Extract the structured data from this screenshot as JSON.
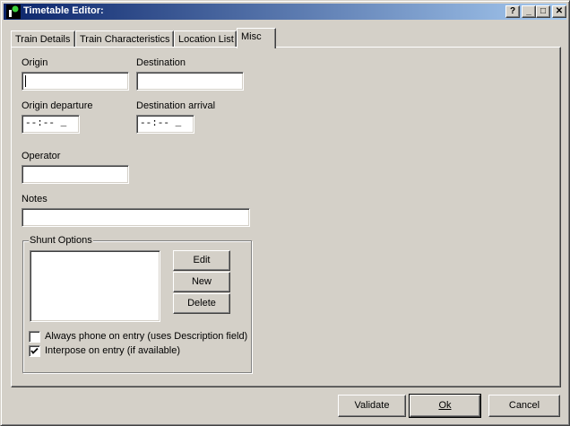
{
  "window": {
    "title": "Timetable Editor:",
    "help_glyph": "?",
    "min_glyph": "_",
    "max_glyph": "□",
    "close_glyph": "✕"
  },
  "tabs": [
    {
      "label": "Train Details",
      "active": false
    },
    {
      "label": "Train Characteristics",
      "active": false
    },
    {
      "label": "Location List",
      "active": false
    },
    {
      "label": "Misc",
      "active": true
    }
  ],
  "misc": {
    "origin_label": "Origin",
    "origin_value": "",
    "destination_label": "Destination",
    "destination_value": "",
    "origin_departure_label": "Origin departure",
    "origin_departure_value": "--:-- _",
    "destination_arrival_label": "Destination arrival",
    "destination_arrival_value": "--:-- _",
    "operator_label": "Operator",
    "operator_value": "",
    "notes_label": "Notes",
    "notes_value": ""
  },
  "shunt": {
    "group_title": "Shunt Options",
    "edit_label": "Edit",
    "new_label": "New",
    "delete_label": "Delete",
    "always_phone_label": "Always phone on entry (uses Description field)",
    "always_phone_checked": false,
    "interpose_label": "Interpose on entry (if available)",
    "interpose_checked": true
  },
  "footer": {
    "validate_label": "Validate",
    "ok_label": "Ok",
    "cancel_label": "Cancel"
  },
  "colors": {
    "title_start": "#0a246a",
    "title_end": "#a6caf0",
    "face": "#d4d0c8"
  }
}
